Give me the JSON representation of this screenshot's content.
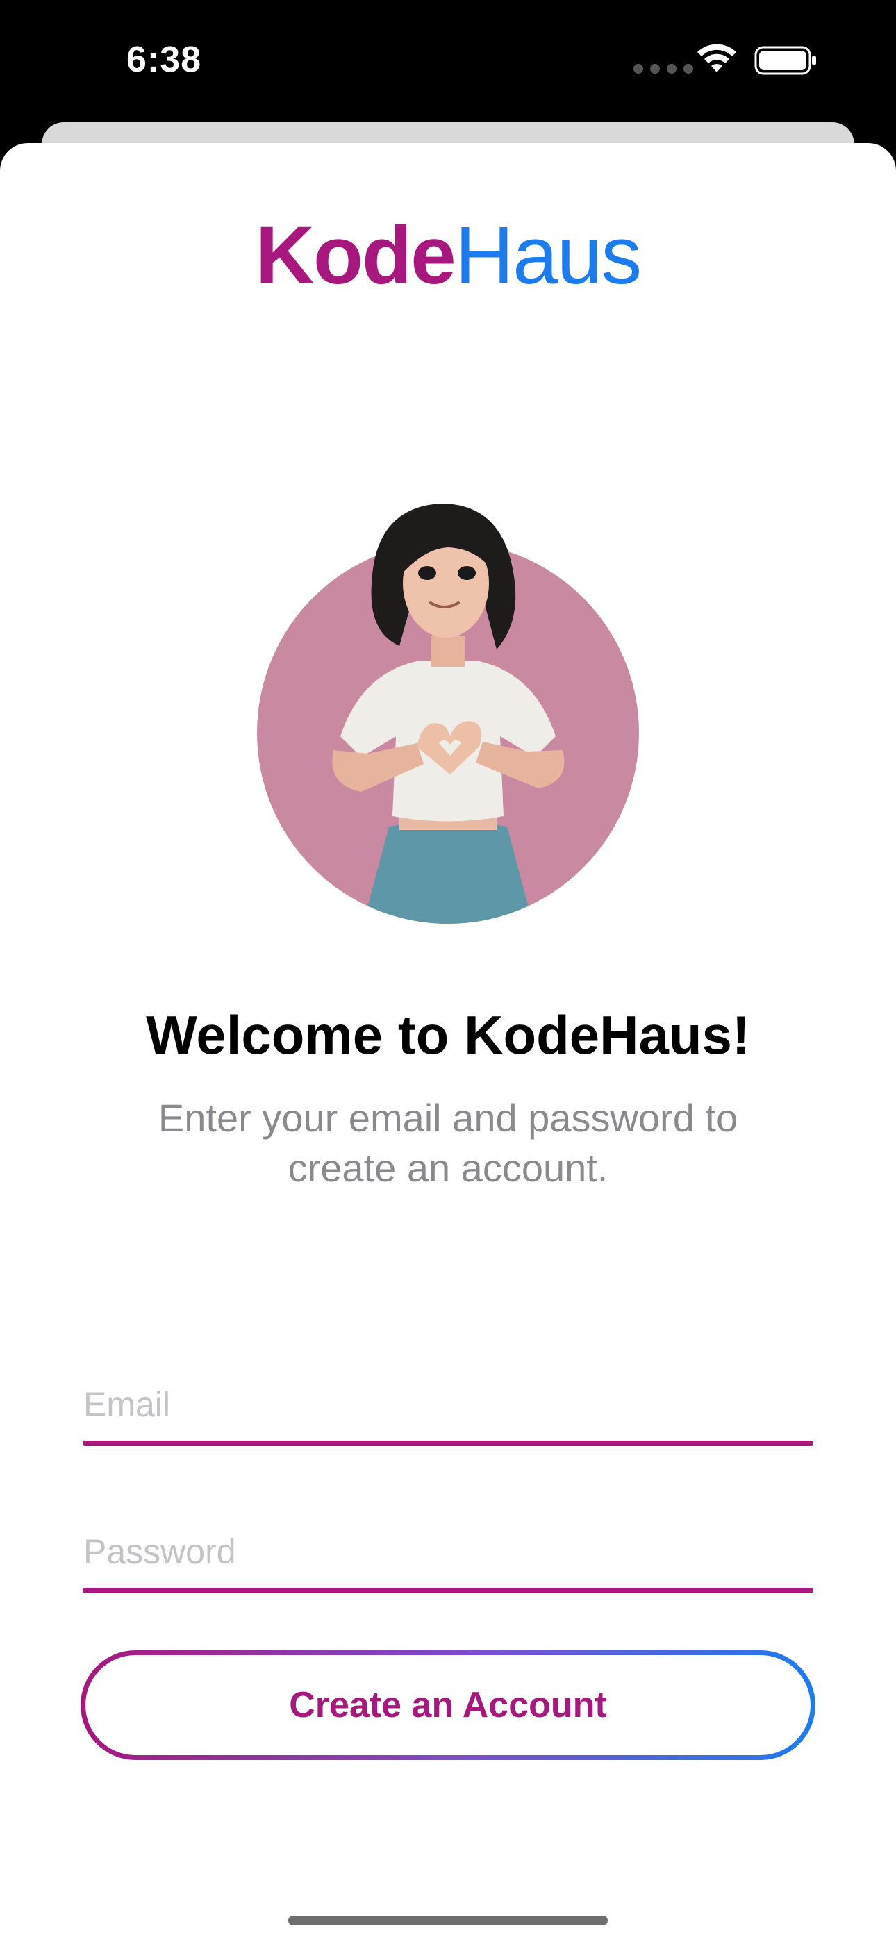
{
  "status_bar": {
    "time": "6:38"
  },
  "logo": {
    "part1": "Kode",
    "part2": "Haus",
    "part1_color": "#a8177e",
    "part2_color": "#1a7cf0"
  },
  "avatar": {
    "icon": "avatar-illustration",
    "background_color": "#c98aa1"
  },
  "welcome": {
    "title": "Welcome to KodeHaus!",
    "subtitle": "Enter your email and password to create an account."
  },
  "form": {
    "email": {
      "value": "",
      "placeholder": "Email"
    },
    "password": {
      "value": "",
      "placeholder": "Password"
    },
    "underline_color": "#a8177e"
  },
  "actions": {
    "create_account_label": "Create an Account",
    "gradient": [
      "#a8177e",
      "#1a7cf0"
    ]
  }
}
